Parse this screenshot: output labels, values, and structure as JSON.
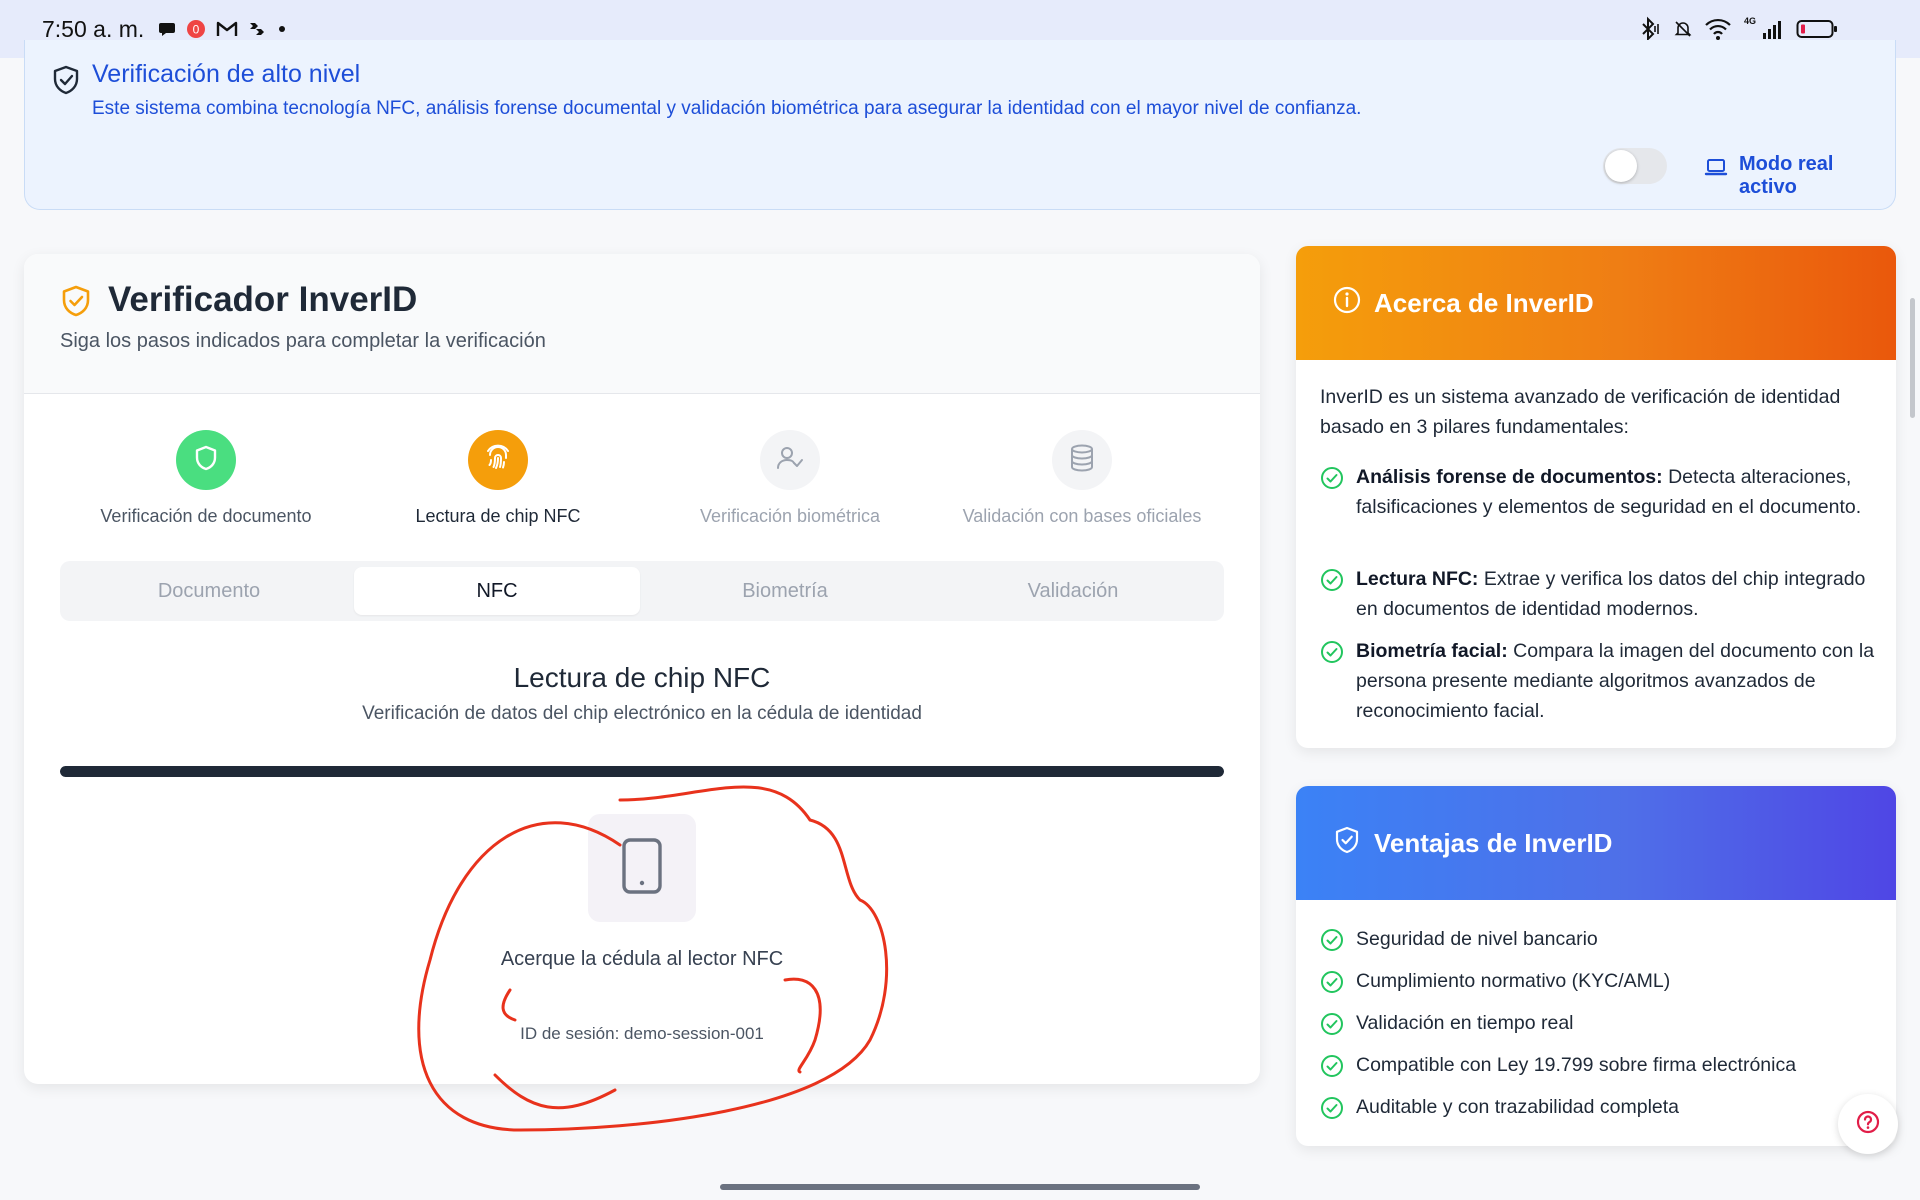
{
  "status_bar": {
    "time": "7:50 a. m.",
    "notification_badge": "0",
    "network_label": "4G",
    "battery_color": "#e11d48"
  },
  "banner": {
    "title": "Verificación de alto nivel",
    "description": "Este sistema combina tecnología NFC, análisis forense documental y validación biométrica para asegurar la identidad con el mayor nivel de confianza.",
    "toggle_on": false,
    "mode_label": "Modo real activo"
  },
  "verifier": {
    "title": "Verificador InverID",
    "subtitle": "Siga los pasos indicados para completar la verificación",
    "steps": [
      {
        "label": "Verificación de documento",
        "state": "completed",
        "icon": "shield-icon",
        "color": "#4ade80"
      },
      {
        "label": "Lectura de chip NFC",
        "state": "active",
        "icon": "fingerprint-icon",
        "color": "#f59e0b"
      },
      {
        "label": "Verificación biométrica",
        "state": "pending",
        "icon": "user-check-icon",
        "color": "#f3f4f6"
      },
      {
        "label": "Validación con bases oficiales",
        "state": "pending",
        "icon": "database-icon",
        "color": "#f3f4f6"
      }
    ],
    "tabs": [
      {
        "label": "Documento",
        "active": false
      },
      {
        "label": "NFC",
        "active": true
      },
      {
        "label": "Biometría",
        "active": false
      },
      {
        "label": "Validación",
        "active": false
      }
    ],
    "section_title": "Lectura de chip NFC",
    "section_subtitle": "Verificación de datos del chip electrónico en la cédula de identidad",
    "progress": 1.0,
    "instruction": "Acerque la cédula al lector NFC",
    "session_id": "ID de sesión: demo-session-001"
  },
  "about": {
    "title": "Acerca de InverID",
    "intro": "InverID es un sistema avanzado de verificación de identidad basado en 3 pilares fundamentales:",
    "features": [
      {
        "bold": "Análisis forense de documentos:",
        "text": " Detecta alteraciones, falsificaciones y elementos de seguridad en el documento."
      },
      {
        "bold": "Lectura NFC:",
        "text": " Extrae y verifica los datos del chip integrado en documentos de identidad modernos."
      },
      {
        "bold": "Biometría facial:",
        "text": " Compara la imagen del documento con la persona presente mediante algoritmos avanzados de reconocimiento facial."
      }
    ]
  },
  "advantages": {
    "title": "Ventajas de InverID",
    "items": [
      "Seguridad de nivel bancario",
      "Cumplimiento normativo (KYC/AML)",
      "Validación en tiempo real",
      "Compatible con Ley 19.799 sobre firma electrónica",
      "Auditable y con trazabilidad completa"
    ]
  },
  "colors": {
    "accent_blue": "#1d4ed8",
    "success_green": "#22c55e",
    "warning_orange": "#f59e0b",
    "annotation_red": "#e8321c"
  }
}
